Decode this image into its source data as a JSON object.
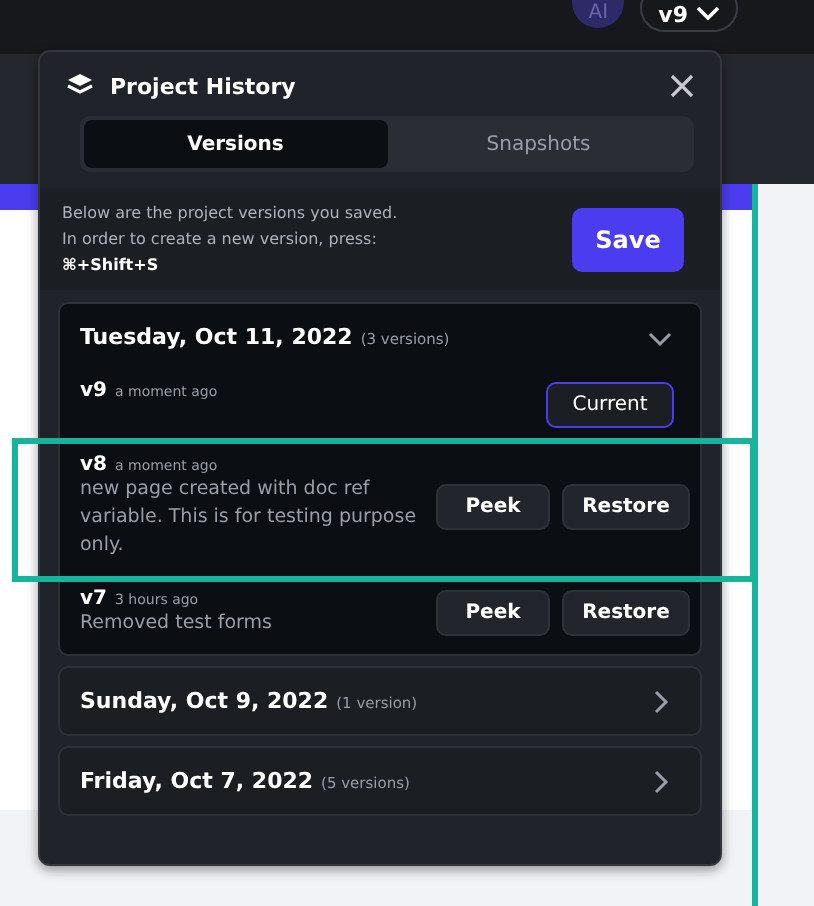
{
  "topbar": {
    "avatar": "AI",
    "version": "v9"
  },
  "panel": {
    "title": "Project History",
    "tabs": [
      {
        "label": "Versions",
        "selected": true
      },
      {
        "label": "Snapshots",
        "selected": false
      }
    ],
    "info": {
      "text": "Below are the project versions you saved.\nIn order to create a new version, press:",
      "shortcut": "⌘+Shift+S"
    },
    "save": "Save",
    "groups": [
      {
        "date": "Tuesday, Oct 11, 2022",
        "count": "(3 versions)",
        "expanded": true,
        "versions": [
          {
            "kind": "current",
            "name": "v9",
            "time": "a moment ago",
            "button": "Current",
            "highlighted": false
          },
          {
            "kind": "past",
            "name": "v8",
            "time": "a moment ago",
            "description": "new page created with doc ref variable. This is for testing purpose only.",
            "actions": [
              "Peek",
              "Restore"
            ],
            "highlighted": true
          },
          {
            "kind": "past",
            "name": "v7",
            "time": "3 hours ago",
            "description": "Removed test forms",
            "actions": [
              "Peek",
              "Restore"
            ],
            "highlighted": false
          }
        ]
      },
      {
        "date": "Sunday, Oct 9, 2022",
        "count": "(1 version)",
        "expanded": false
      },
      {
        "date": "Friday, Oct 7, 2022",
        "count": "(5 versions)",
        "expanded": false
      }
    ]
  }
}
